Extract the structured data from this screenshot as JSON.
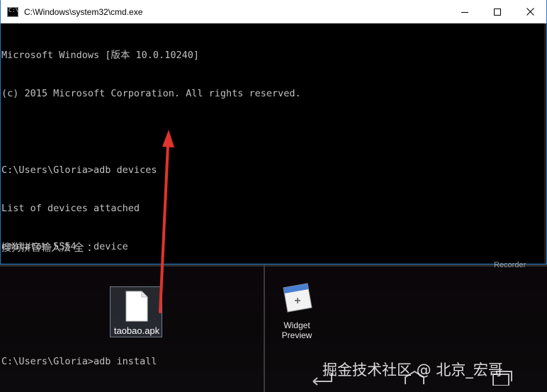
{
  "window": {
    "title": "C:\\Windows\\system32\\cmd.exe",
    "icon_prompt": "C:\\",
    "controls": [
      "minimize-icon",
      "maximize-icon",
      "close-icon"
    ]
  },
  "console": {
    "lines": [
      "Microsoft Windows [版本 10.0.10240]",
      "(c) 2015 Microsoft Corporation. All rights reserved.",
      "",
      "C:\\Users\\Gloria>adb devices",
      "List of devices attached",
      "emulator-5554   device",
      "",
      "",
      "C:\\Users\\Gloria>adb install"
    ],
    "ime_status": "搜狗拼音输入法 全 ："
  },
  "desktop": {
    "apk_file": {
      "label": "taobao.apk",
      "icon": "file-icon"
    },
    "widget_preview": {
      "label_line1": "Widget",
      "label_line2": "Preview",
      "icon": "widget-preview-icon"
    },
    "recorder_label": "Recorder"
  },
  "watermark": "掘金技术社区 @ 北京_宏哥",
  "colors": {
    "console_bg": "#000000",
    "console_text": "#c0c0c0",
    "window_border": "#1e78c8",
    "arrow": "#e0342c"
  }
}
